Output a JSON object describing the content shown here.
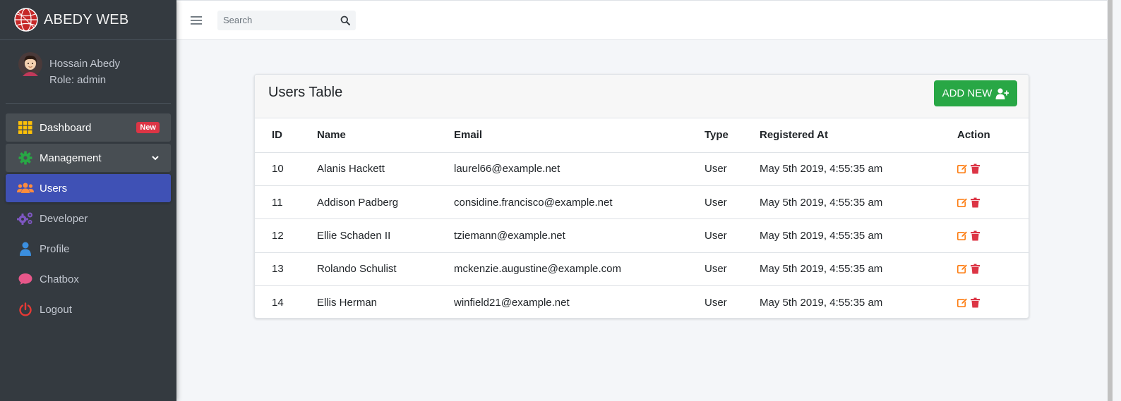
{
  "brand": {
    "name": "ABEDY WEB"
  },
  "user": {
    "name": "Hossain Abedy",
    "role": "Role: admin"
  },
  "sidebar": {
    "items": [
      {
        "label": "Dashboard",
        "icon": "grid-icon",
        "badge": "New"
      },
      {
        "label": "Management",
        "icon": "gear-icon",
        "expandable": true
      },
      {
        "label": "Users",
        "icon": "users-icon",
        "active": true
      },
      {
        "label": "Developer",
        "icon": "cogs-icon"
      },
      {
        "label": "Profile",
        "icon": "user-icon"
      },
      {
        "label": "Chatbox",
        "icon": "chat-icon"
      },
      {
        "label": "Logout",
        "icon": "power-icon"
      }
    ]
  },
  "topbar": {
    "search_placeholder": "Search"
  },
  "card": {
    "title": "Users Table",
    "add_button": "ADD NEW"
  },
  "table": {
    "headers": [
      "ID",
      "Name",
      "Email",
      "Type",
      "Registered At",
      "Action"
    ],
    "rows": [
      {
        "id": "10",
        "name": "Alanis Hackett",
        "email": "laurel66@example.net",
        "type": "User",
        "registered": "May 5th 2019, 4:55:35 am"
      },
      {
        "id": "11",
        "name": "Addison Padberg",
        "email": "considine.francisco@example.net",
        "type": "User",
        "registered": "May 5th 2019, 4:55:35 am"
      },
      {
        "id": "12",
        "name": "Ellie Schaden II",
        "email": "tziemann@example.net",
        "type": "User",
        "registered": "May 5th 2019, 4:55:35 am"
      },
      {
        "id": "13",
        "name": "Rolando Schulist",
        "email": "mckenzie.augustine@example.com",
        "type": "User",
        "registered": "May 5th 2019, 4:55:35 am"
      },
      {
        "id": "14",
        "name": "Ellis Herman",
        "email": "winfield21@example.net",
        "type": "User",
        "registered": "May 5th 2019, 4:55:35 am"
      }
    ]
  },
  "colors": {
    "sidebar_bg": "#343a40",
    "active_item": "#3f51b5",
    "add_button": "#28a745",
    "badge": "#dc3545",
    "edit_icon": "#fd7e14",
    "delete_icon": "#dc3545"
  }
}
